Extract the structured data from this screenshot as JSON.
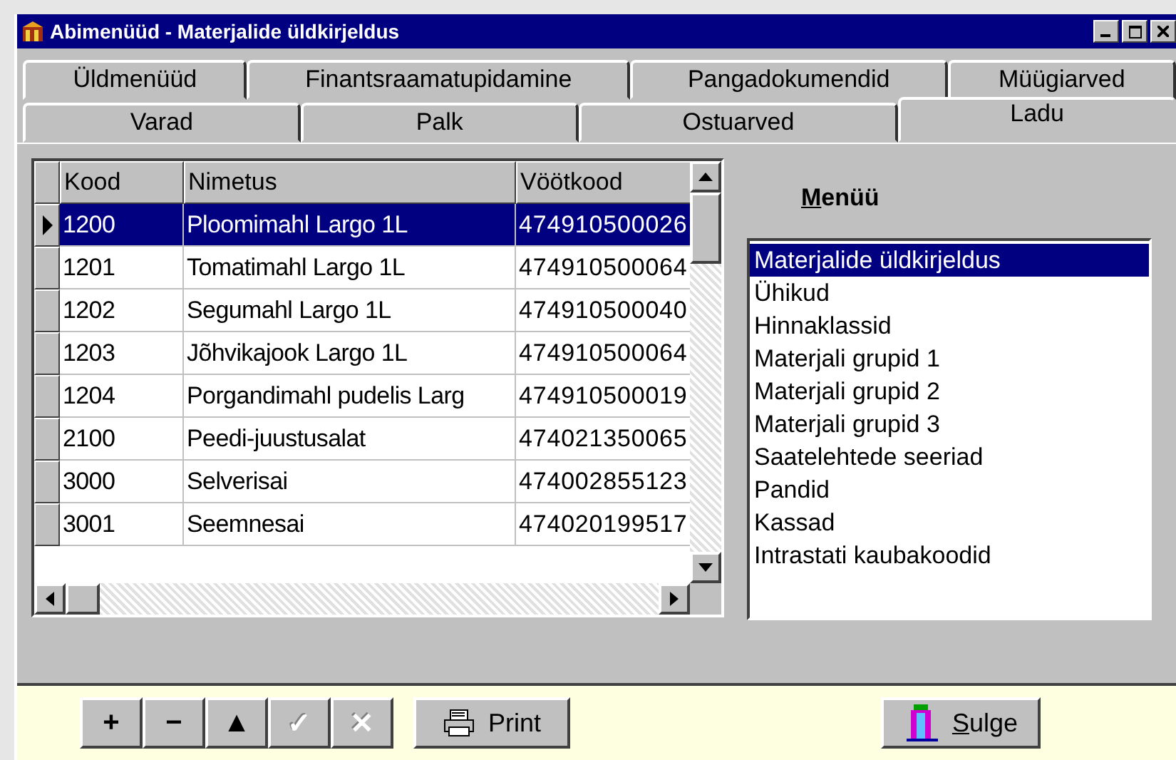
{
  "window": {
    "title": "Abimenüüd - Materjalide üldkirjeldus"
  },
  "tab_rows": [
    [
      {
        "label": "Üldmenüüd",
        "selected": false
      },
      {
        "label": "Finantsraamatupidamine",
        "selected": false
      },
      {
        "label": "Pangadokumendid",
        "selected": false
      },
      {
        "label": "Müügiarved",
        "selected": false
      }
    ],
    [
      {
        "label": "Varad",
        "selected": false
      },
      {
        "label": "Palk",
        "selected": false
      },
      {
        "label": "Ostuarved",
        "selected": false
      },
      {
        "label": "Ladu",
        "selected": true
      }
    ]
  ],
  "table": {
    "columns": [
      "Kood",
      "Nimetus",
      "Vöötkood"
    ],
    "rows": [
      {
        "cells": [
          "1200",
          "Ploomimahl Largo 1L",
          "474910500026"
        ],
        "selected": true
      },
      {
        "cells": [
          "1201",
          "Tomatimahl Largo 1L",
          "474910500064"
        ],
        "selected": false
      },
      {
        "cells": [
          "1202",
          "Segumahl Largo 1L",
          "474910500040"
        ],
        "selected": false
      },
      {
        "cells": [
          "1203",
          "Jõhvikajook Largo 1L",
          "474910500064"
        ],
        "selected": false
      },
      {
        "cells": [
          "1204",
          "Porgandimahl pudelis Larg",
          "474910500019"
        ],
        "selected": false
      },
      {
        "cells": [
          "2100",
          "Peedi-juustusalat",
          "474021350065"
        ],
        "selected": false
      },
      {
        "cells": [
          "3000",
          "Selverisai",
          "474002855123"
        ],
        "selected": false
      },
      {
        "cells": [
          "3001",
          "Seemnesai",
          "474020199517"
        ],
        "selected": false
      }
    ]
  },
  "menu": {
    "label": "Menüü",
    "items": [
      {
        "label": "Materjalide üldkirjeldus",
        "selected": true
      },
      {
        "label": "Ühikud",
        "selected": false
      },
      {
        "label": "Hinnaklassid",
        "selected": false
      },
      {
        "label": "Materjali grupid 1",
        "selected": false
      },
      {
        "label": "Materjali grupid 2",
        "selected": false
      },
      {
        "label": "Materjali grupid 3",
        "selected": false
      },
      {
        "label": "Saatelehtede seeriad",
        "selected": false
      },
      {
        "label": "Pandid",
        "selected": false
      },
      {
        "label": "Kassad",
        "selected": false
      },
      {
        "label": "Intrastati kaubakoodid",
        "selected": false
      }
    ]
  },
  "toolbar": [
    {
      "kind": "glyph",
      "label": "+",
      "disabled": false
    },
    {
      "kind": "glyph",
      "label": "−",
      "disabled": false
    },
    {
      "kind": "glyph",
      "label": "▲",
      "disabled": false
    },
    {
      "kind": "glyph",
      "label": "✓",
      "disabled": true
    },
    {
      "kind": "glyph",
      "label": "✕",
      "disabled": true
    },
    {
      "kind": "print",
      "label": "Print",
      "disabled": false
    },
    {
      "kind": "close",
      "label": "Sulge",
      "disabled": false
    }
  ]
}
